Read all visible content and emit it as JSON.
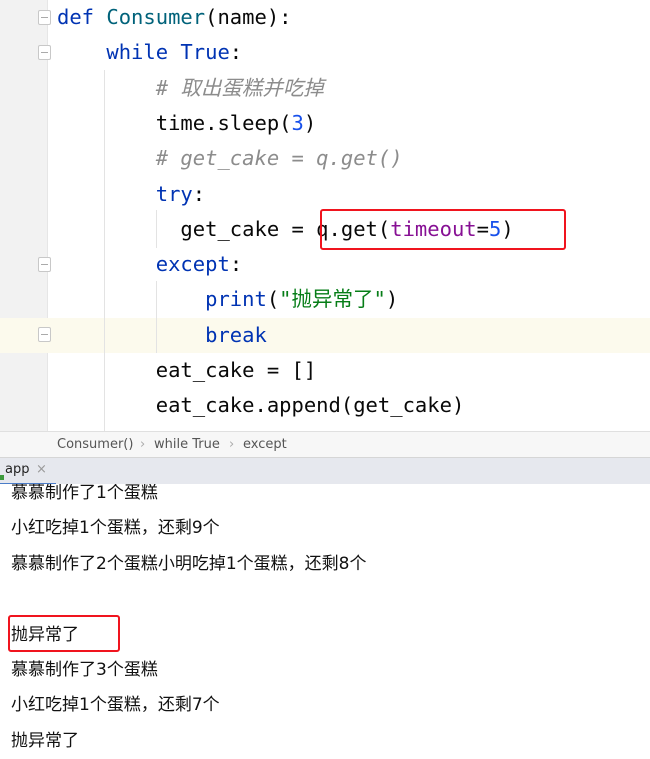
{
  "editor": {
    "lines": [
      {
        "tokens": [
          [
            "kw",
            "def "
          ],
          [
            "fn",
            "Consumer"
          ],
          [
            "plain",
            "(name):"
          ]
        ]
      },
      {
        "tokens": [
          [
            "plain",
            "    "
          ],
          [
            "kw",
            "while True"
          ],
          [
            "plain",
            ":"
          ]
        ]
      },
      {
        "tokens": [
          [
            "cm",
            "        # 取出蛋糕并吃掉"
          ]
        ]
      },
      {
        "tokens": [
          [
            "plain",
            "        time.sleep("
          ],
          [
            "num",
            "3"
          ],
          [
            "plain",
            ")"
          ]
        ]
      },
      {
        "tokens": [
          [
            "cm",
            "        # get_cake = q.get()"
          ]
        ]
      },
      {
        "tokens": [
          [
            "plain",
            "        "
          ],
          [
            "kw",
            "try"
          ],
          [
            "plain",
            ":"
          ]
        ]
      },
      {
        "tokens": [
          [
            "plain",
            "          get_cake = q.get("
          ],
          [
            "param",
            "timeout"
          ],
          [
            "plain",
            "="
          ],
          [
            "num",
            "5"
          ],
          [
            "plain",
            ")"
          ]
        ]
      },
      {
        "tokens": [
          [
            "plain",
            "        "
          ],
          [
            "kw",
            "except"
          ],
          [
            "plain",
            ":"
          ]
        ]
      },
      {
        "tokens": [
          [
            "plain",
            "            "
          ],
          [
            "kw",
            "print"
          ],
          [
            "plain",
            "("
          ],
          [
            "str",
            "\"抛异常了\""
          ],
          [
            "plain",
            ")"
          ]
        ]
      },
      {
        "tokens": [
          [
            "plain",
            "            "
          ],
          [
            "kw",
            "break"
          ]
        ]
      },
      {
        "tokens": [
          [
            "plain",
            "        eat_cake = []"
          ]
        ]
      },
      {
        "tokens": [
          [
            "plain",
            "        eat_cake.append(get_cake)"
          ]
        ]
      }
    ],
    "current_line": 9,
    "highlight_color": "#f0141e"
  },
  "breadcrumb": [
    "Consumer()",
    "while True",
    "except"
  ],
  "breadcrumb_sep": "›",
  "run_tab": {
    "label": "app",
    "close": "×"
  },
  "console": {
    "lines": [
      "慕慕制作了1个蛋糕",
      "小红吃掉1个蛋糕，还剩9个",
      "慕慕制作了2个蛋糕小明吃掉1个蛋糕，还剩8个",
      "",
      "抛异常了",
      "慕慕制作了3个蛋糕",
      "小红吃掉1个蛋糕，还剩7个",
      "抛异常了"
    ]
  }
}
